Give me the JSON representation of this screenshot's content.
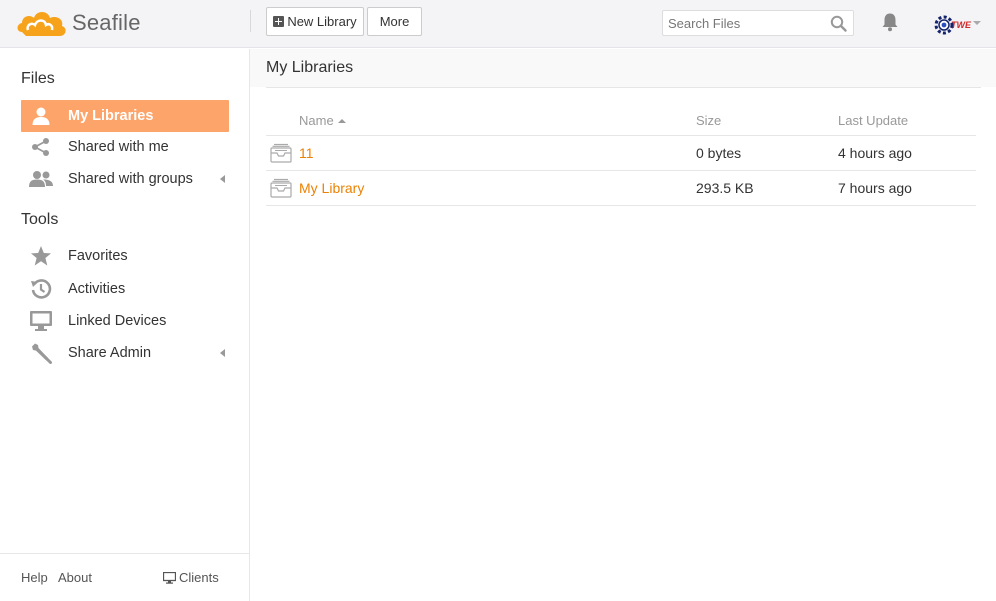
{
  "app": {
    "logo_text": "Seafile"
  },
  "toolbar": {
    "new_library_label": "New Library",
    "more_label": "More"
  },
  "search": {
    "placeholder": "Search Files"
  },
  "header": {
    "avatar_text": "TWE"
  },
  "sidebar": {
    "files_heading": "Files",
    "files_items": [
      {
        "label": "My Libraries",
        "icon": "user-icon",
        "active": true
      },
      {
        "label": "Shared with me",
        "icon": "share-icon",
        "active": false
      },
      {
        "label": "Shared with groups",
        "icon": "group-icon",
        "active": false
      }
    ],
    "tools_heading": "Tools",
    "tools_items": [
      {
        "label": "Favorites",
        "icon": "star-icon"
      },
      {
        "label": "Activities",
        "icon": "history-icon"
      },
      {
        "label": "Linked Devices",
        "icon": "monitor-icon"
      },
      {
        "label": "Share Admin",
        "icon": "wrench-icon"
      }
    ],
    "footer": {
      "help": "Help",
      "about": "About",
      "clients": "Clients"
    }
  },
  "main": {
    "title": "My Libraries",
    "columns": {
      "name": "Name",
      "size": "Size",
      "last_update": "Last Update"
    },
    "rows": [
      {
        "name": "11",
        "size": "0 bytes",
        "last_update": "4 hours ago"
      },
      {
        "name": "My Library",
        "size": "293.5 KB",
        "last_update": "7 hours ago"
      }
    ]
  },
  "colors": {
    "accent": "#fda46a",
    "link": "#eb8205",
    "logo": "#f7a21b"
  }
}
